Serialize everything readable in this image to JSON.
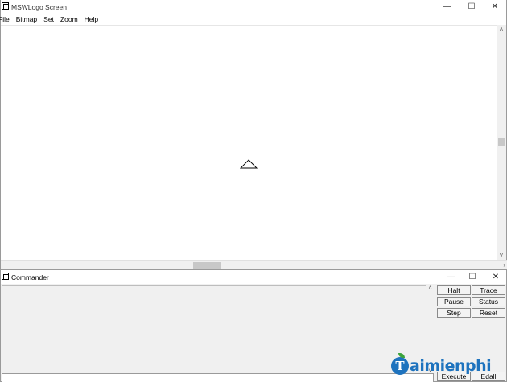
{
  "main_window": {
    "title": "MSWLogo Screen",
    "controls": {
      "minimize": "—",
      "maximize": "☐",
      "close": "✕"
    },
    "menu": [
      "File",
      "Bitmap",
      "Set",
      "Zoom",
      "Help"
    ]
  },
  "commander": {
    "title": "Commander",
    "controls": {
      "minimize": "—",
      "maximize": "☐",
      "close": "✕"
    },
    "buttons": {
      "halt": "Halt",
      "trace": "Trace",
      "pause": "Pause",
      "status": "Status",
      "step": "Step",
      "reset": "Reset",
      "execute": "Execute",
      "edall": "Edall"
    },
    "input_value": ""
  },
  "watermark": {
    "logo_letter": "T",
    "text": "aimienphi"
  },
  "colors": {
    "watermark": "#1e73be",
    "window_bg": "#f0f0f0",
    "canvas": "#ffffff"
  }
}
